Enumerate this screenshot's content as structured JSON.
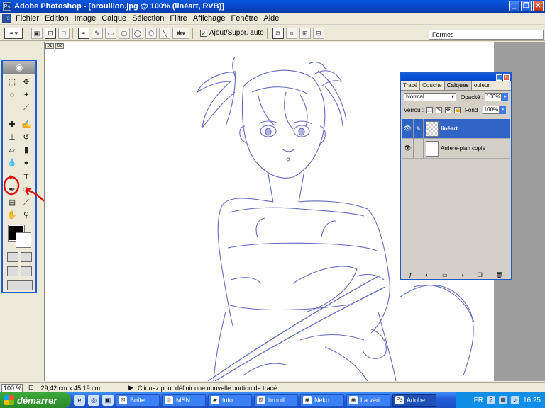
{
  "window": {
    "title": "Adobe Photoshop - [brouillon.jpg @ 100% (linéart, RVB)]",
    "minimize": "_",
    "restore": "❐",
    "close": "✕"
  },
  "menubar": {
    "items": [
      "Fichier",
      "Edition",
      "Image",
      "Calque",
      "Sélection",
      "Filtre",
      "Affichage",
      "Fenêtre",
      "Aide"
    ]
  },
  "options": {
    "auto_label": "Ajout/Suppr. auto",
    "auto_checked": true,
    "formes_label": "Formes"
  },
  "document": {
    "tab_labels": [
      "01",
      "02"
    ]
  },
  "toolbox": {
    "selected_tool": "pen-icon",
    "foreground_color": "#000000",
    "background_color": "#ffffff"
  },
  "layers_panel": {
    "tabs": [
      "Tracé",
      "Couche",
      "Calques",
      "ouleur"
    ],
    "active_tab": "Calques",
    "blend_mode": "Normal",
    "opacity_label": "Opacité :",
    "opacity_value": "100%",
    "lock_label": "Verrou :",
    "fill_label": "Fond :",
    "fill_value": "100%",
    "layers": [
      {
        "name": "linéart",
        "selected": true
      },
      {
        "name": "Arrière-plan copie",
        "selected": false
      }
    ]
  },
  "statusbar": {
    "zoom": "100 %",
    "doc_size": "29,42 cm x 45,19 cm",
    "hint": "Cliquez pour définir une nouvelle portion de tracé."
  },
  "taskbar": {
    "start_label": "démarrer",
    "tasks": [
      {
        "label": "Boîte ...",
        "active": false
      },
      {
        "label": "MSN ...",
        "active": false
      },
      {
        "label": "tuto",
        "active": false
      },
      {
        "label": "brouill...",
        "active": false
      },
      {
        "label": "Neko ...",
        "active": false
      },
      {
        "label": "La véri...",
        "active": false
      },
      {
        "label": "Adobe...",
        "active": true
      }
    ],
    "language": "FR",
    "clock": "16:25"
  },
  "colors": {
    "xp_blue": "#0a58e0",
    "sketch_stroke": "#4a4fb0",
    "annotation_red": "#e01010"
  }
}
